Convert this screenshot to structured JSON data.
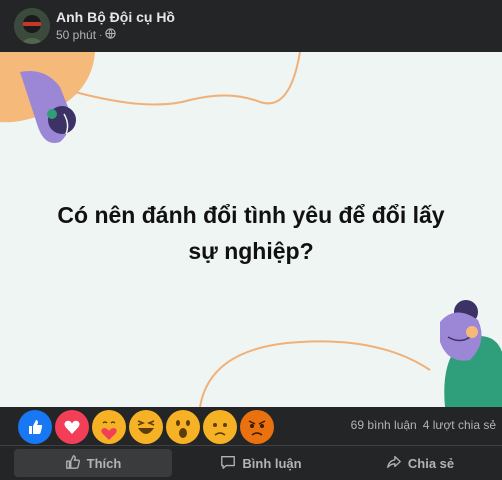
{
  "post": {
    "author": "Anh Bộ Đội cụ Hồ",
    "time": "50 phút",
    "separator": "·",
    "privacy_icon": "globe-icon",
    "question_line1": "Có nên đánh đổi tình yêu để đổi lấy",
    "question_line2": "sự nghiệp?"
  },
  "reactions": [
    "like",
    "love",
    "care",
    "haha",
    "wow",
    "sad",
    "angry"
  ],
  "stats": {
    "comments": "69 bình luận",
    "shares": "4 lượt chia sẻ"
  },
  "actions": {
    "like": "Thích",
    "comment": "Bình luận",
    "share": "Chia sẻ"
  },
  "colors": {
    "background": "#242526",
    "card_bg": "#eef5f3",
    "accent_orange": "#f5b97a",
    "accent_purple": "#9b87d6",
    "accent_green": "#2f9e7a"
  }
}
